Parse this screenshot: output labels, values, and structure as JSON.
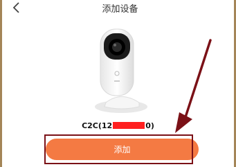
{
  "header": {
    "title": "添加设备",
    "back_icon": "chevron-left-icon"
  },
  "device": {
    "image_icon": "camera-icon",
    "model_prefix": "C2C(12",
    "model_suffix": "0)"
  },
  "actions": {
    "add_label": "添加"
  },
  "colors": {
    "accent": "#f47a43",
    "annotation": "#7b1117",
    "redaction": "#ff1f1f"
  }
}
